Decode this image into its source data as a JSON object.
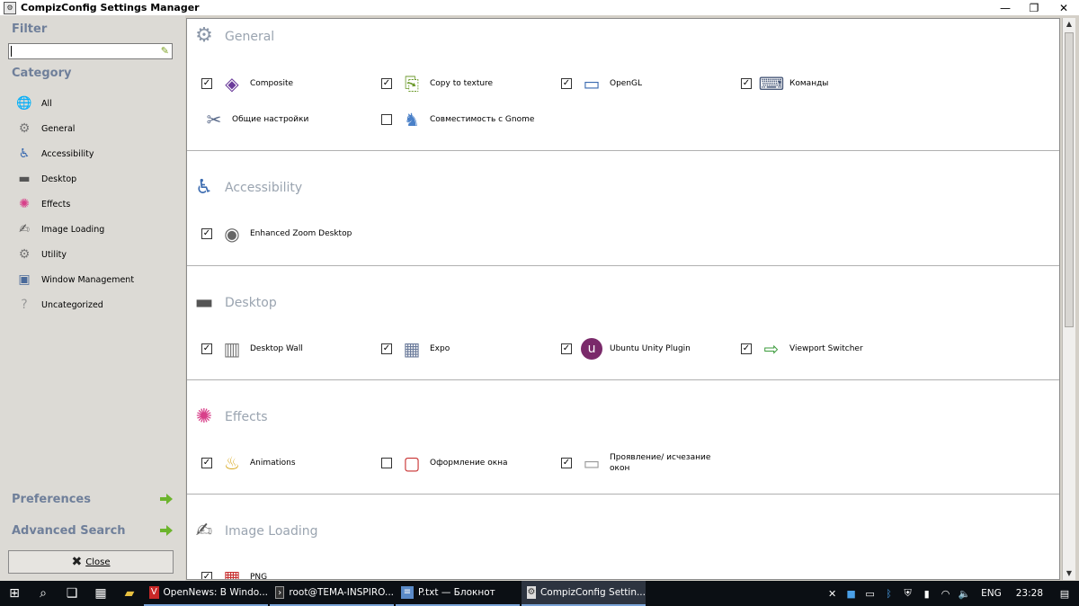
{
  "window": {
    "title": "CompizConfig Settings Manager"
  },
  "sidebar": {
    "filter_label": "Filter",
    "filter_value": "",
    "category_label": "Category",
    "categories": [
      {
        "label": "All",
        "icon": "globe-icon"
      },
      {
        "label": "General",
        "icon": "gear-icon"
      },
      {
        "label": "Accessibility",
        "icon": "wheelchair-icon"
      },
      {
        "label": "Desktop",
        "icon": "desktop-icon"
      },
      {
        "label": "Effects",
        "icon": "fireworks-icon"
      },
      {
        "label": "Image Loading",
        "icon": "paint-icon"
      },
      {
        "label": "Utility",
        "icon": "gear-icon"
      },
      {
        "label": "Window Management",
        "icon": "window-icon"
      },
      {
        "label": "Uncategorized",
        "icon": "question-icon"
      }
    ],
    "preferences_label": "Preferences",
    "advanced_search_label": "Advanced Search",
    "close_label": "Close"
  },
  "sections": [
    {
      "title": "General",
      "plugins": [
        {
          "label": "Composite",
          "checked": true
        },
        {
          "label": "Copy to texture",
          "checked": true
        },
        {
          "label": "OpenGL",
          "checked": true
        },
        {
          "label": "Команды",
          "checked": true
        },
        {
          "label": "Общие настройки",
          "checked": null
        },
        {
          "label": "Совместимость с Gnome",
          "checked": false
        }
      ]
    },
    {
      "title": "Accessibility",
      "plugins": [
        {
          "label": "Enhanced Zoom Desktop",
          "checked": true
        }
      ]
    },
    {
      "title": "Desktop",
      "plugins": [
        {
          "label": "Desktop Wall",
          "checked": true
        },
        {
          "label": "Expo",
          "checked": true
        },
        {
          "label": "Ubuntu Unity Plugin",
          "checked": true
        },
        {
          "label": "Viewport Switcher",
          "checked": true
        }
      ]
    },
    {
      "title": "Effects",
      "plugins": [
        {
          "label": "Animations",
          "checked": true
        },
        {
          "label": "Оформление окна",
          "checked": false
        },
        {
          "label": "Проявление/ исчезание окон",
          "checked": true
        }
      ]
    },
    {
      "title": "Image Loading",
      "plugins": [
        {
          "label": "PNG",
          "checked": true
        }
      ]
    }
  ],
  "taskbar": {
    "apps": [
      {
        "label": "OpenNews: В Windo...",
        "icon": "vivaldi-icon"
      },
      {
        "label": "root@TEMA-INSPIRO...",
        "icon": "terminal-icon"
      },
      {
        "label": "P.txt — Блокнот",
        "icon": "notepad-icon"
      },
      {
        "label": "CompizConfig Settin...",
        "icon": "compiz-icon"
      }
    ],
    "language": "ENG",
    "time": "23:28"
  },
  "colors": {
    "section_title": "#9aa4b0",
    "sidebar_title": "#6f7f9a",
    "taskbar": "#0b0f14"
  }
}
